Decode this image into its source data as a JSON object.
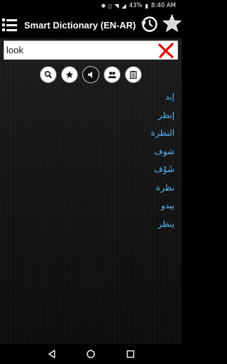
{
  "status_bar": {
    "battery": "43%",
    "time": "8:40 AM"
  },
  "app_bar": {
    "title": "Smart Dictionary (EN-AR)"
  },
  "search": {
    "value": "look"
  },
  "toolbar": {
    "buttons": [
      "search-icon",
      "star-icon",
      "speaker-icon",
      "users-icon",
      "clipboard-icon"
    ]
  },
  "results": {
    "items": [
      "إبد",
      "إنظر",
      "النظرة",
      "شوف",
      "شَوْف",
      "نظرة",
      "يبدو",
      "ينظر"
    ]
  },
  "colors": {
    "result_text": "#5ab5f2",
    "clear_icon": "#e00000",
    "background": "#141414"
  }
}
